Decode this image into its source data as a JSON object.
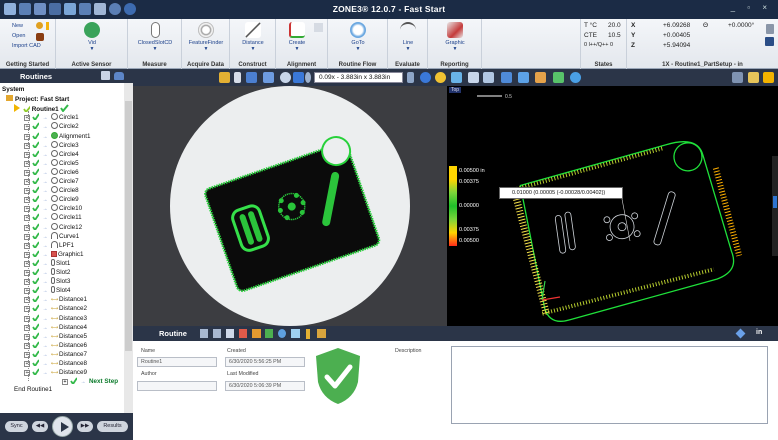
{
  "titlebar": {
    "title": "ZONE3® 12.0.7 - Fast Start",
    "window_controls": "_ ▫ ×"
  },
  "ribbon": {
    "groups": [
      {
        "name": "Getting Started"
      },
      {
        "name": "Active Sensor"
      },
      {
        "name": "Measure"
      },
      {
        "name": "Acquire Data"
      },
      {
        "name": "Construct"
      },
      {
        "name": "Alignment"
      },
      {
        "name": "Routine Flow"
      },
      {
        "name": "Evaluate"
      },
      {
        "name": "Reporting"
      },
      {
        "name": "States"
      }
    ],
    "getting_started": {
      "new": "New",
      "open": "Open",
      "import_cad": "Import CAD"
    },
    "buttons": [
      {
        "label": "Vid"
      },
      {
        "label": "ClosedSlotCD"
      },
      {
        "label": "FeatureFinder"
      },
      {
        "label": "Distance"
      },
      {
        "label": "Create"
      },
      {
        "label": "GoTo"
      },
      {
        "label": "Line"
      },
      {
        "label": "Graphic"
      }
    ],
    "states": {
      "temp_label": "T °C",
      "temp_value": "20.0",
      "cte_label": "CTE",
      "cte_value": "10.5",
      "tol_label": "0 l++/Q++ 0"
    },
    "dro": {
      "x_label": "X",
      "x_value": "+6.09268",
      "theta_label": "Θ",
      "theta_value": "+0.0000°",
      "y_label": "Y",
      "y_value": "+0.00405",
      "z_label": "Z",
      "z_value": "+5.94094",
      "setup": "1X - Routine1_PartSetup - in"
    }
  },
  "routines_panel": {
    "title": "Routines",
    "tree": [
      {
        "label": "System",
        "level": 0,
        "kind": "root"
      },
      {
        "label": "Project: Fast Start",
        "level": 1,
        "kind": "project"
      },
      {
        "label": "Routine1",
        "level": 2,
        "kind": "routine"
      },
      {
        "label": "Circle1",
        "level": 3,
        "kind": "circle"
      },
      {
        "label": "Circle2",
        "level": 3,
        "kind": "circle"
      },
      {
        "label": "Alignment1",
        "level": 3,
        "kind": "alignment"
      },
      {
        "label": "Circle3",
        "level": 3,
        "kind": "circle"
      },
      {
        "label": "Circle4",
        "level": 3,
        "kind": "circle"
      },
      {
        "label": "Circle5",
        "level": 3,
        "kind": "circle"
      },
      {
        "label": "Circle6",
        "level": 3,
        "kind": "circle"
      },
      {
        "label": "Circle7",
        "level": 3,
        "kind": "circle"
      },
      {
        "label": "Circle8",
        "level": 3,
        "kind": "circle"
      },
      {
        "label": "Circle9",
        "level": 3,
        "kind": "circle"
      },
      {
        "label": "Circle10",
        "level": 3,
        "kind": "circle"
      },
      {
        "label": "Circle11",
        "level": 3,
        "kind": "circle"
      },
      {
        "label": "Circle12",
        "level": 3,
        "kind": "circle"
      },
      {
        "label": "Curve1",
        "level": 3,
        "kind": "curve"
      },
      {
        "label": "LPF1",
        "level": 3,
        "kind": "filter"
      },
      {
        "label": "Graphic1",
        "level": 3,
        "kind": "graphic"
      },
      {
        "label": "Slot1",
        "level": 3,
        "kind": "slot"
      },
      {
        "label": "Slot2",
        "level": 3,
        "kind": "slot"
      },
      {
        "label": "Slot3",
        "level": 3,
        "kind": "slot"
      },
      {
        "label": "Slot4",
        "level": 3,
        "kind": "slot"
      },
      {
        "label": "Distance1",
        "level": 3,
        "kind": "distance"
      },
      {
        "label": "Distance2",
        "level": 3,
        "kind": "distance"
      },
      {
        "label": "Distance3",
        "level": 3,
        "kind": "distance"
      },
      {
        "label": "Distance4",
        "level": 3,
        "kind": "distance"
      },
      {
        "label": "Distance5",
        "level": 3,
        "kind": "distance"
      },
      {
        "label": "Distance6",
        "level": 3,
        "kind": "distance"
      },
      {
        "label": "Distance7",
        "level": 3,
        "kind": "distance"
      },
      {
        "label": "Distance8",
        "level": 3,
        "kind": "distance"
      },
      {
        "label": "Distance9",
        "level": 3,
        "kind": "distance"
      },
      {
        "label": "Next Step",
        "level": 3,
        "kind": "next"
      },
      {
        "label": "End Routine1",
        "level": 2,
        "kind": "end"
      }
    ],
    "playbar": {
      "sync": "Sync",
      "results": "Results"
    }
  },
  "viewport": {
    "zoom_field": "0.09x - 3.883in x 3.883in",
    "view_label": "Top",
    "scale_label": "0.5",
    "callout": "0.01000 (0.00005 (-0.00028/0.00402))",
    "colorbar": {
      "top": "0.00500 in",
      "t2": "0.00375",
      "mid": "0.00000",
      "b2": "0.00375",
      "bottom": "0.00500"
    },
    "colorbar_colors": [
      "#ffd500",
      "#ffd500",
      "#7bd53a",
      "#1fbe2a",
      "#7bd53a",
      "#ffd500",
      "#ff2b1a"
    ]
  },
  "routine_detail": {
    "title": "Routine",
    "name_label": "Name",
    "name_value": "Routine1",
    "created_label": "Created",
    "created_value": "6/30/2020 5:56:25 PM",
    "author_label": "Author",
    "author_value": "",
    "modified_label": "Last Modified",
    "modified_value": "6/30/2020 5:06:39 PM",
    "description_label": "Description",
    "status_color": "#4caf50"
  },
  "colors": {
    "accent": "#1b2b45",
    "panel_header": "#2b3548",
    "pass_green": "#2ecc40",
    "brand_blue": "#1a3f8a"
  }
}
